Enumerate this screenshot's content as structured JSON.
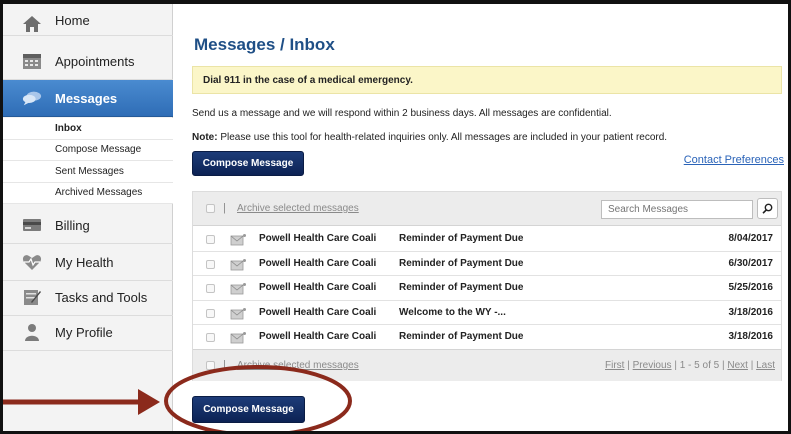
{
  "sidebar": {
    "items": [
      {
        "label": "Home",
        "icon": "home-icon"
      },
      {
        "label": "Appointments",
        "icon": "calendar-icon"
      },
      {
        "label": "Messages",
        "icon": "chat-bubble-icon"
      },
      {
        "label": "Billing",
        "icon": "credit-card-icon"
      },
      {
        "label": "My Health",
        "icon": "heart-pulse-icon"
      },
      {
        "label": "Tasks and Tools",
        "icon": "clipboard-icon"
      },
      {
        "label": "My Profile",
        "icon": "person-icon"
      }
    ],
    "subitems": [
      {
        "label": "Inbox"
      },
      {
        "label": "Compose Message"
      },
      {
        "label": "Sent Messages"
      },
      {
        "label": "Archived Messages"
      }
    ]
  },
  "main": {
    "title": "Messages / Inbox",
    "alert": "Dial 911 in the case of a medical emergency.",
    "intro": "Send us a message and we will respond within 2 business days. All messages are confidential.",
    "note_label": "Note:",
    "note_text": " Please use this tool for health-related inquiries only. All messages are included in your patient record.",
    "compose_label": "Compose Message",
    "contact_label": "Contact Preferences"
  },
  "table": {
    "archive_label": "Archive selected messages",
    "separator": "|",
    "search_placeholder": "Search Messages",
    "rows": [
      {
        "from": "Powell Health Care Coali",
        "subject": "Reminder of Payment Due",
        "date": "8/04/2017"
      },
      {
        "from": "Powell Health Care Coali",
        "subject": "Reminder of Payment Due",
        "date": "6/30/2017"
      },
      {
        "from": "Powell Health Care Coali",
        "subject": "Reminder of Payment Due",
        "date": "5/25/2016"
      },
      {
        "from": "Powell Health Care Coali",
        "subject": "Welcome to the WY -...",
        "date": "3/18/2016"
      },
      {
        "from": "Powell Health Care Coali",
        "subject": "Reminder of Payment Due",
        "date": "3/18/2016"
      }
    ],
    "pager": {
      "first": "First",
      "previous": "Previous",
      "range": "1 - 5 of 5",
      "next": "Next",
      "last": "Last"
    }
  },
  "colors": {
    "accent_blue": "#2f6db6",
    "button_navy": "#0c2254",
    "alert_yellow": "#fbf6c8",
    "annotation_red": "#8b2a1c"
  }
}
